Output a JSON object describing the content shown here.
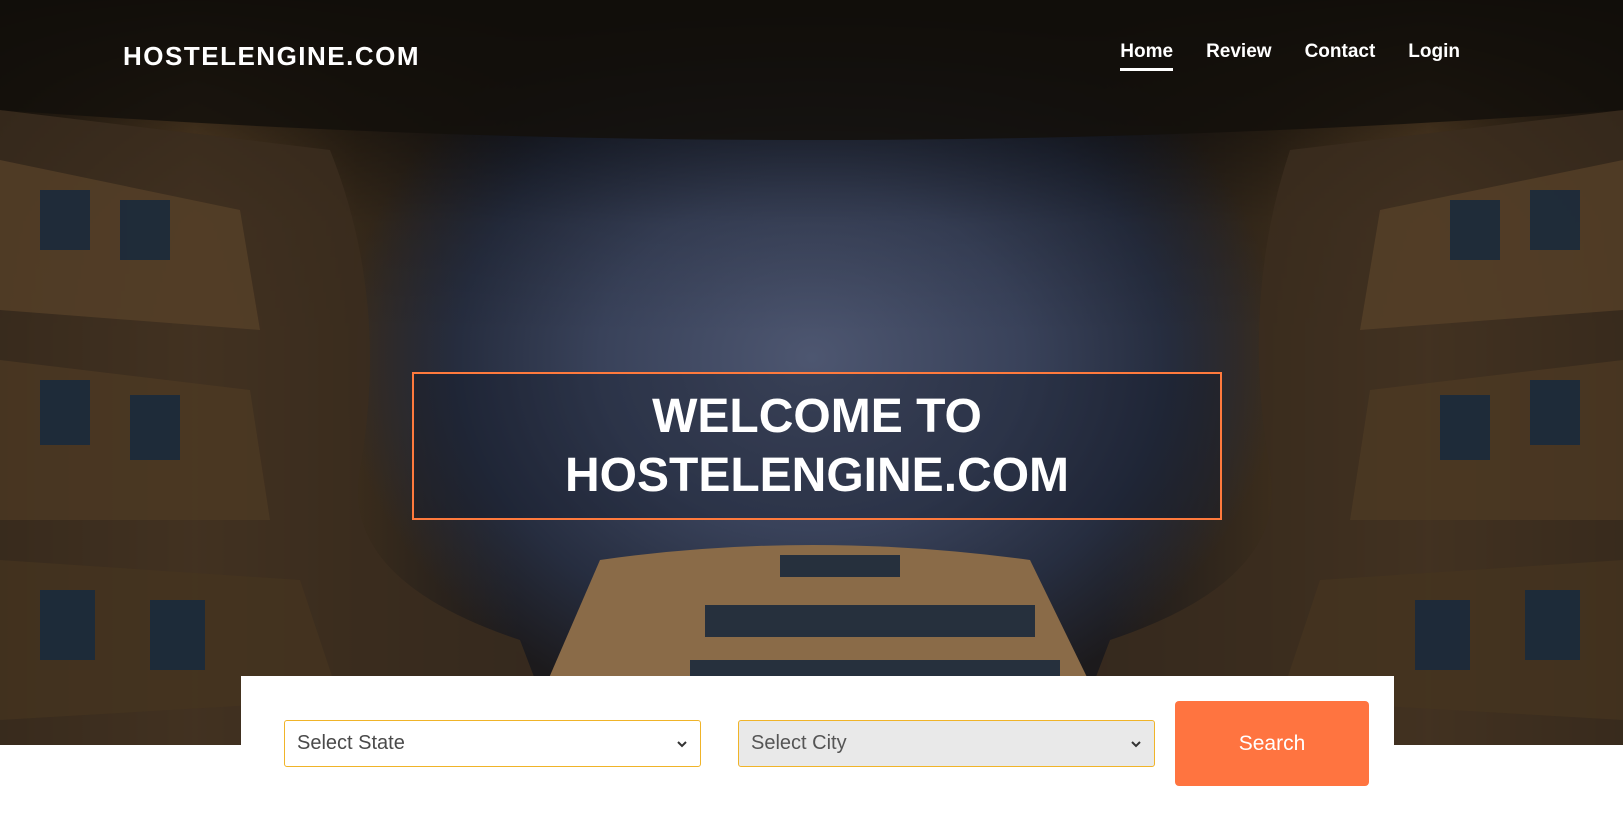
{
  "header": {
    "brand": "HOSTELENGINE.COM",
    "nav": [
      {
        "label": "Home",
        "active": true
      },
      {
        "label": "Review",
        "active": false
      },
      {
        "label": "Contact",
        "active": false
      },
      {
        "label": "Login",
        "active": false
      }
    ]
  },
  "hero": {
    "title_line1": "WELCOME TO",
    "title_line2": "HOSTELENGINE.COM"
  },
  "search": {
    "state_select": "Select State",
    "city_select": "Select City",
    "button_label": "Search"
  },
  "colors": {
    "accent": "#ff7440",
    "select_border": "#f0b429",
    "box_border": "#ff7a3d"
  }
}
